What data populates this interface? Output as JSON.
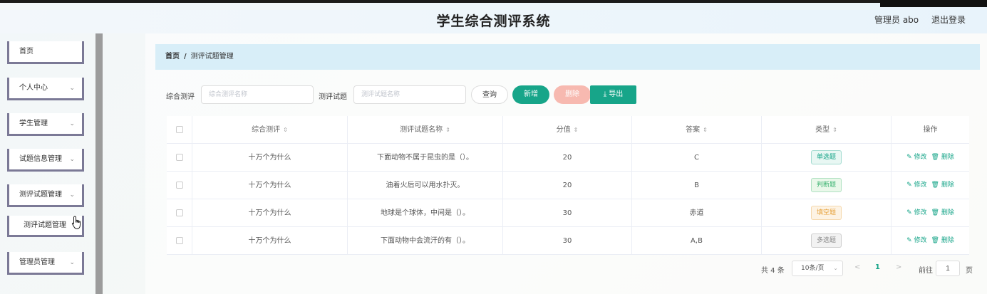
{
  "header": {
    "title": "学生综合测评系统",
    "user_label": "管理员 abo",
    "logout_label": "退出登录"
  },
  "sidebar": {
    "items": [
      {
        "label": "首页"
      },
      {
        "label": "个人中心",
        "chevron": "⌄"
      },
      {
        "label": "学生管理",
        "chevron": "⌄"
      },
      {
        "label": "试题信息管理",
        "chevron": "⌄"
      },
      {
        "label": "测评试题管理",
        "chevron": "⌄"
      },
      {
        "label": "测评试题管理"
      },
      {
        "label": "管理员管理",
        "chevron": "⌄"
      }
    ]
  },
  "breadcrumb": {
    "home": "首页",
    "separator": "/",
    "current": "测评试题管理"
  },
  "filters": {
    "eval_label": "综合测评",
    "eval_placeholder": "综合测评名称",
    "question_label": "测评试题",
    "question_placeholder": "测评试题名称"
  },
  "buttons": {
    "query": "查询",
    "add": "新增",
    "delete": "删除",
    "export": "⤓ 导出"
  },
  "table": {
    "headers": {
      "eval": "综合测评",
      "question": "测评试题名称",
      "score": "分值",
      "answer": "答案",
      "type": "类型",
      "ops": "操作"
    },
    "sort_icon": "⇕",
    "rows": [
      {
        "eval": "十万个为什么",
        "question": "下面动物不属于昆虫的是（）。",
        "score": "20",
        "answer": "C",
        "type": "单选题",
        "type_color": "#17a589",
        "type_bg": "#e8f7f3"
      },
      {
        "eval": "十万个为什么",
        "question": "油着火后可以用水扑灭。",
        "score": "20",
        "answer": "B",
        "type": "判断题",
        "type_color": "#3cb371",
        "type_bg": "#eaf8ea"
      },
      {
        "eval": "十万个为什么",
        "question": "地球是个球体，中间是（）。",
        "score": "30",
        "answer": "赤道",
        "type": "填空题",
        "type_color": "#e6a23c",
        "type_bg": "#fdf3e4"
      },
      {
        "eval": "十万个为什么",
        "question": "下面动物中会流汗的有（）。",
        "score": "30",
        "answer": "A,B",
        "type": "多选题",
        "type_color": "#888888",
        "type_bg": "#f2f2f2"
      }
    ],
    "op_edit": "✎ 修改",
    "op_delete": "🗑 删除"
  },
  "pagination": {
    "total_text": "共 4 条",
    "page_size": "10条/页",
    "prev": "<",
    "current_page": "1",
    "next": ">",
    "goto_label": "前往",
    "goto_value": "1",
    "page_suffix": "页"
  }
}
